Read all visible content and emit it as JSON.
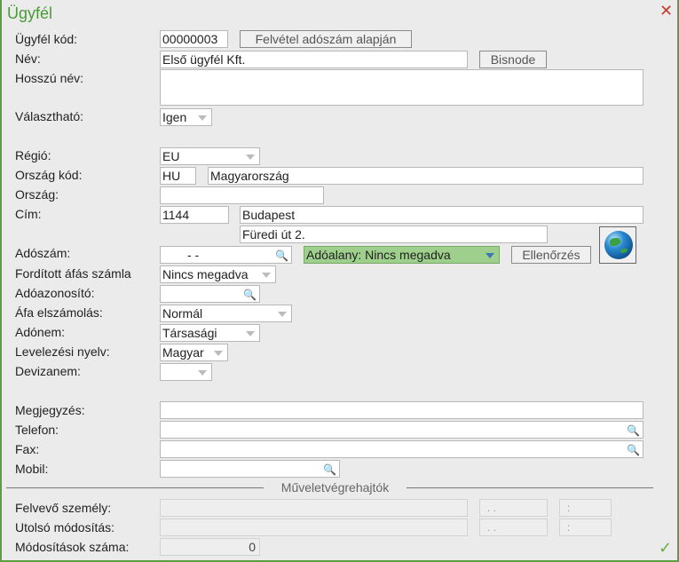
{
  "title": "Ügyfél",
  "labels": {
    "code": "Ügyfél kód:",
    "name": "Név:",
    "long_name": "Hosszú név:",
    "selectable": "Választható:",
    "region": "Régió:",
    "country_code": "Ország kód:",
    "country": "Ország:",
    "address": "Cím:",
    "tax_number": "Adószám:",
    "reverse_vat": "Fordított áfás számla",
    "tax_id": "Adóazonosító:",
    "vat_accounting": "Áfa elszámolás:",
    "tax_type": "Adónem:",
    "mail_language": "Levelezési nyelv:",
    "currency": "Devizanem:",
    "note": "Megjegyzés:",
    "phone": "Telefon:",
    "fax": "Fax:",
    "mobile": "Mobil:",
    "created_by": "Felvevő személy:",
    "last_modified": "Utolsó módosítás:",
    "modification_count": "Módosítások száma:"
  },
  "values": {
    "code": "00000003",
    "name": "Első ügyfél Kft.",
    "long_name": "",
    "selectable": "Igen",
    "region": "EU",
    "country_code": "HU",
    "country_name": "Magyarország",
    "country": "",
    "zip": "1144",
    "city": "Budapest",
    "street": "Füredi út 2.",
    "tax_number": "- -",
    "taxpayer_status": "Adóalany: Nincs megadva",
    "reverse_vat": "Nincs megadva",
    "tax_id": "",
    "vat_accounting": "Normál",
    "tax_type": "Társasági",
    "mail_language": "Magyar",
    "currency": "",
    "note": "",
    "phone": "",
    "fax": "",
    "mobile": "",
    "created_date": ". .",
    "created_time": ":",
    "modified_date": ". .",
    "modified_time": ":",
    "modification_count": "0"
  },
  "buttons": {
    "create_from_tax": "Felvétel adószám alapján",
    "bisnode": "Bisnode",
    "check": "Ellenőrzés"
  },
  "section": "Műveletvégrehajtók"
}
